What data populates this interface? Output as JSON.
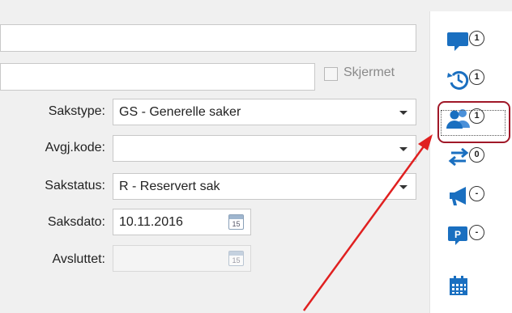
{
  "form": {
    "checkbox_label": "Skjermet",
    "rows": [
      {
        "label": "Sakstype:",
        "value": "GS - Generelle saker"
      },
      {
        "label": "Avgj.kode:",
        "value": ""
      },
      {
        "label": "Sakstatus:",
        "value": "R - Reservert sak"
      }
    ],
    "saksdato": {
      "label": "Saksdato:",
      "value": "10.11.2016",
      "cal_day": "15"
    },
    "avsluttet": {
      "label": "Avsluttet:",
      "value": "",
      "cal_day": "15"
    }
  },
  "sidebar": {
    "items": [
      {
        "icon": "comment-icon",
        "badge": "1"
      },
      {
        "icon": "history-icon",
        "badge": "1"
      },
      {
        "icon": "people-icon",
        "badge": "1"
      },
      {
        "icon": "transfer-icon",
        "badge": "0"
      },
      {
        "icon": "megaphone-icon",
        "badge": "-"
      },
      {
        "icon": "parking-icon",
        "badge": "-"
      },
      {
        "icon": "calendar-icon",
        "badge": ""
      }
    ]
  },
  "colors": {
    "accent": "#1a6fc0",
    "highlight": "#a01828",
    "arrow": "#e02020"
  }
}
